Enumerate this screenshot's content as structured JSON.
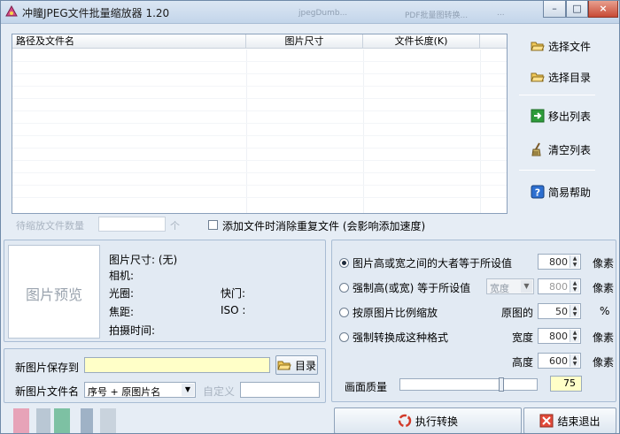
{
  "window": {
    "title": "冲瞳JPEG文件批量缩放器 1.20",
    "background_tabs": [
      "jpegDumb...",
      "PDF批量图转换...",
      "..."
    ],
    "minimize_glyph": "–",
    "maximize_glyph": "□",
    "close_glyph": "×"
  },
  "file_list": {
    "columns": [
      "路径及文件名",
      "图片尺寸",
      "文件长度(K)"
    ],
    "rows": []
  },
  "side_buttons": {
    "select_file": "选择文件",
    "select_dir": "选择目录",
    "remove": "移出列表",
    "clear": "清空列表",
    "help": "简易帮助"
  },
  "pending": {
    "label": "待缩放文件数量",
    "unit": "个",
    "value": ""
  },
  "dedupe": {
    "label": "添加文件时消除重复文件 (会影响添加速度)",
    "checked": false
  },
  "preview": {
    "placeholder": "图片预览",
    "size_label": "图片尺寸: (无)",
    "camera_label": "相机:",
    "aperture_label": "光圈:",
    "shutter_label": "快门:",
    "focal_label": "焦距:",
    "iso_label": "ISO :",
    "time_label": "拍摄时间:"
  },
  "resize": {
    "options": [
      "图片高或宽之间的大者等于所设值",
      "强制高(或宽) 等于所设值",
      "按原图片比例缩放",
      "强制转换成这种格式"
    ],
    "selected_index": 0,
    "max_value": "800",
    "max_unit": "像素",
    "force_combo": "宽度",
    "force_value": "800",
    "force_unit": "像素",
    "percent_label": "原图的",
    "percent_value": "50",
    "percent_unit": "%",
    "width_label": "宽度",
    "width_value": "800",
    "width_unit": "像素",
    "height_label": "高度",
    "height_value": "600",
    "height_unit": "像素",
    "quality_label": "画面质量",
    "quality_value": "75",
    "quality_fraction": 0.75
  },
  "save": {
    "path_label": "新图片保存到",
    "path_value": "",
    "dir_button": "目录",
    "name_label": "新图片文件名",
    "name_option": "序号 + 原图片名",
    "custom_label": "自定义",
    "custom_value": ""
  },
  "actions": {
    "run": "执行转换",
    "exit": "结束退出"
  },
  "colors": {
    "accent_yellow": "#ffffc8",
    "panel_bg": "#e2eaf3"
  }
}
